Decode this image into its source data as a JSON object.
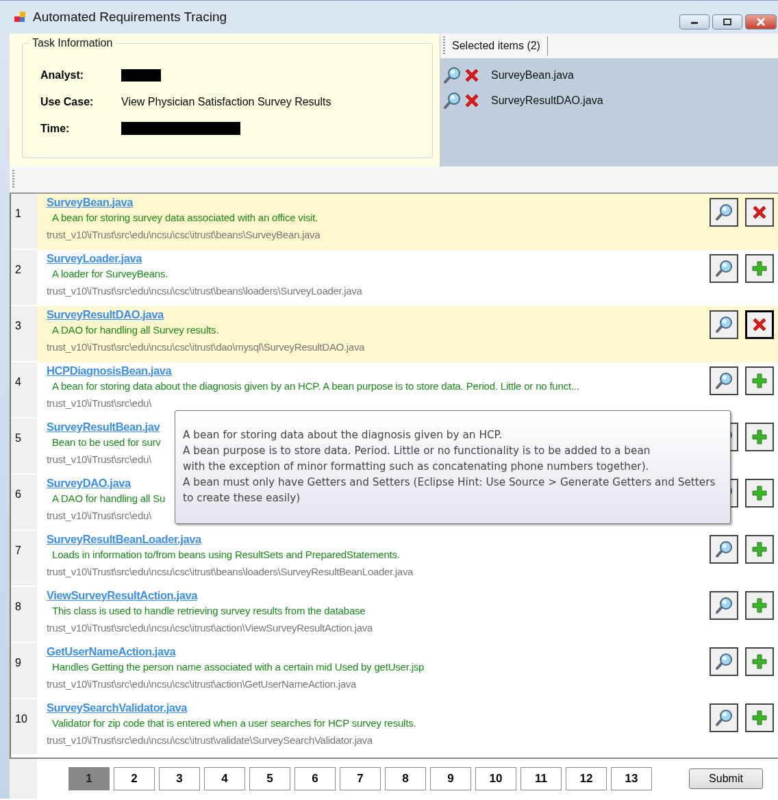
{
  "window": {
    "title": "Automated Requirements Tracing"
  },
  "task_info": {
    "title": "Task Information",
    "fields": [
      {
        "label": "Analyst:",
        "redacted": true
      },
      {
        "label": "Use Case:",
        "value": "View Physician Satisfaction Survey Results"
      },
      {
        "label": "Time:",
        "redacted": true
      }
    ]
  },
  "selected_panel": {
    "tab": "Selected items (2)",
    "items": [
      "SurveyBean.java",
      "SurveyResultDAO.java"
    ]
  },
  "results": [
    {
      "number": "1",
      "title": "SurveyBean.java",
      "description": "A bean for storing survey data associated with an office visit.",
      "path": "trust_v10\\iTrust\\src\\edu\\ncsu\\csc\\itrust\\beans\\SurveyBean.java",
      "selected": true,
      "focused": false
    },
    {
      "number": "2",
      "title": "SurveyLoader.java",
      "description": "A loader for SurveyBeans.",
      "path": "trust_v10\\iTrust\\src\\edu\\ncsu\\csc\\itrust\\beans\\loaders\\SurveyLoader.java",
      "selected": false,
      "focused": false
    },
    {
      "number": "3",
      "title": "SurveyResultDAO.java",
      "description": "A DAO for handling all Survey results.",
      "path": "trust_v10\\iTrust\\src\\edu\\ncsu\\csc\\itrust\\dao\\mysql\\SurveyResultDAO.java",
      "selected": true,
      "focused": true
    },
    {
      "number": "4",
      "title": "HCPDiagnosisBean.java",
      "description": "A bean for storing data about the diagnosis given by an HCP. A bean purpose is to store data. Period. Little or no funct...",
      "path": "trust_v10\\iTrust\\src\\edu\\",
      "selected": false,
      "focused": false
    },
    {
      "number": "5",
      "title": "SurveyResultBean.jav",
      "description": "Bean to be used for surv",
      "path": "trust_v10\\iTrust\\src\\edu\\",
      "selected": false,
      "focused": false
    },
    {
      "number": "6",
      "title": "SurveyDAO.java",
      "description": "A DAO for handling all Su",
      "path": "trust_v10\\iTrust\\src\\edu\\",
      "selected": false,
      "focused": false
    },
    {
      "number": "7",
      "title": "SurveyResultBeanLoader.java",
      "description": "Loads in information to/from beans using ResultSets and PreparedStatements.",
      "path": "trust_v10\\iTrust\\src\\edu\\ncsu\\csc\\itrust\\beans\\loaders\\SurveyResultBeanLoader.java",
      "selected": false,
      "focused": false
    },
    {
      "number": "8",
      "title": "ViewSurveyResultAction.java",
      "description": "This class is used to handle retrieving survey results from the database",
      "path": "trust_v10\\iTrust\\src\\edu\\ncsu\\csc\\itrust\\action\\ViewSurveyResultAction.java",
      "selected": false,
      "focused": false
    },
    {
      "number": "9",
      "title": "GetUserNameAction.java",
      "description": "Handles Getting the person name associated with a certain mid Used by getUser.jsp",
      "path": "trust_v10\\iTrust\\src\\edu\\ncsu\\csc\\itrust\\action\\GetUserNameAction.java",
      "selected": false,
      "focused": false
    },
    {
      "number": "10",
      "title": "SurveySearchValidator.java",
      "description": "Validator for zip code that is entered when a user searches for HCP survey results.",
      "path": "trust_v10\\iTrust\\src\\edu\\ncsu\\csc\\itrust\\validate\\SurveySearchValidator.java",
      "selected": false,
      "focused": false
    }
  ],
  "tooltip": {
    "lines": [
      "A bean for storing data about the diagnosis given by an HCP.",
      "A bean purpose is to store data. Period. Little or no functionality is to be added to a bean",
      "with the exception of minor formatting such as concatenating phone numbers together).",
      "A bean must only have Getters and Setters (Eclipse Hint: Use Source > Generate Getters and Setters",
      "to create these easily)"
    ]
  },
  "pagination": [
    {
      "label": "1",
      "selected": true
    },
    {
      "label": "2",
      "selected": false
    },
    {
      "label": "3",
      "selected": false
    },
    {
      "label": "4",
      "selected": false
    },
    {
      "label": "5",
      "selected": false
    },
    {
      "label": "6",
      "selected": false
    },
    {
      "label": "7",
      "selected": false
    },
    {
      "label": "8",
      "selected": false
    },
    {
      "label": "9",
      "selected": false
    },
    {
      "label": "10",
      "selected": false
    },
    {
      "label": "11",
      "selected": false
    },
    {
      "label": "12",
      "selected": false
    },
    {
      "label": "13",
      "selected": false
    }
  ],
  "submit": "Submit"
}
